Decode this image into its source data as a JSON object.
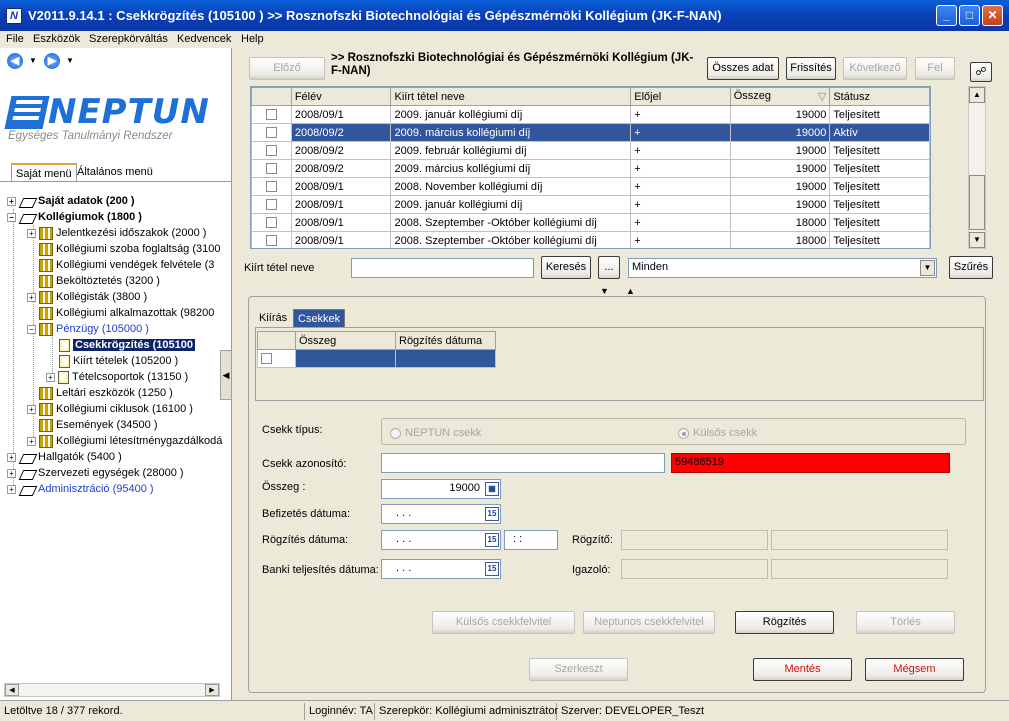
{
  "window": {
    "title": "V2011.9.14.1 : Csekkrögzítés (105100 )  >> Rosznofszki Biotechnológiai és Gépészmérnöki Kollégium (JK-F-NAN)",
    "minimize": "_",
    "maximize": "□",
    "close": "✕",
    "app_icon": "N"
  },
  "menu": [
    "File",
    "Eszközök",
    "Szerepkörváltás",
    "Kedvencek",
    "Help"
  ],
  "nav": {
    "back": "◀",
    "forward": "▶",
    "dropdown": "▼"
  },
  "logo": {
    "word": "NEPTUN",
    "tagline": "Egységes Tanulmányi Rendszer"
  },
  "left_tabs": [
    "Saját menü",
    "Általános menü"
  ],
  "tree": [
    {
      "label": "Saját adatok (200 )",
      "expander": "+"
    },
    {
      "label": "Kollégiumok (1800 )",
      "expander": "−"
    },
    {
      "label": "Jelentkezési időszakok (2000 )",
      "expander": "+"
    },
    {
      "label": "Kollégiumi szoba foglaltság (3100"
    },
    {
      "label": "Kollégiumi vendégek felvétele (3"
    },
    {
      "label": "Beköltöztetés (3200 )"
    },
    {
      "label": "Kollégisták (3800 )",
      "expander": "+"
    },
    {
      "label": "Kollégiumi alkalmazottak (98200"
    },
    {
      "label": "Pénzügy (105000 )",
      "expander": "−"
    },
    {
      "label": "Csekkrögzítés (105100"
    },
    {
      "label": "Kiírt tételek (105200 )"
    },
    {
      "label": "Tételcsoportok (13150 )",
      "expander": "+"
    },
    {
      "label": "Leltári eszközök (1250 )"
    },
    {
      "label": "Kollégiumi ciklusok (16100 )",
      "expander": "+"
    },
    {
      "label": "Események (34500 )"
    },
    {
      "label": "Kollégiumi létesítménygazdálkodá",
      "expander": "+"
    },
    {
      "label": "Hallgatók (5400 )",
      "expander": "+"
    },
    {
      "label": "Szervezeti egységek (28000 )",
      "expander": "+"
    },
    {
      "label": "Adminisztráció (95400 )",
      "expander": "+"
    }
  ],
  "toolbar": {
    "prev": "Előző",
    "title": ">> Rosznofszki Biotechnológiai és Gépészmérnöki Kollégium (JK-F-NAN)",
    "all_data": "Összes adat",
    "refresh": "Frissítés",
    "next": "Következő",
    "up": "Fel",
    "pin_icon": "☍"
  },
  "items_table": {
    "columns": [
      "",
      "Félév",
      "Kiírt tétel neve",
      "Előjel",
      "Összeg",
      "Státusz"
    ],
    "sort_marker": "▽",
    "rows": [
      {
        "felev": "2008/09/1",
        "nev": "2009. január kollégiumi díj",
        "elojel": "+",
        "osszeg": "19000",
        "statusz": "Teljesített",
        "selected": false
      },
      {
        "felev": "2008/09/2",
        "nev": "2009. március kollégiumi díj",
        "elojel": "+",
        "osszeg": "19000",
        "statusz": "Aktív",
        "selected": true
      },
      {
        "felev": "2008/09/2",
        "nev": "2009. február kollégiumi díj",
        "elojel": "+",
        "osszeg": "19000",
        "statusz": "Teljesített",
        "selected": false
      },
      {
        "felev": "2008/09/2",
        "nev": "2009. március kollégiumi díj",
        "elojel": "+",
        "osszeg": "19000",
        "statusz": "Teljesített",
        "selected": false
      },
      {
        "felev": "2008/09/1",
        "nev": "2008. November kollégiumi díj",
        "elojel": "+",
        "osszeg": "19000",
        "statusz": "Teljesített",
        "selected": false
      },
      {
        "felev": "2008/09/1",
        "nev": "2009. január kollégiumi díj",
        "elojel": "+",
        "osszeg": "19000",
        "statusz": "Teljesített",
        "selected": false
      },
      {
        "felev": "2008/09/1",
        "nev": "2008. Szeptember -Október kollégiumi díj",
        "elojel": "+",
        "osszeg": "18000",
        "statusz": "Teljesített",
        "selected": false
      },
      {
        "felev": "2008/09/1",
        "nev": "2008. Szeptember -Október kollégiumi díj",
        "elojel": "+",
        "osszeg": "18000",
        "statusz": "Teljesített",
        "selected": false
      }
    ]
  },
  "filter": {
    "label": "Kiírt tétel neve",
    "value": "",
    "search": "Keresés",
    "ellipsis": "...",
    "select_value": "Minden",
    "filter_btn": "Szűrés"
  },
  "splitter": {
    "down": "▼",
    "up": "▲"
  },
  "tabs": [
    "Kiírás",
    "Csekkek"
  ],
  "check_table": {
    "columns": [
      "",
      "Összeg",
      "Rögzítés dátuma"
    ]
  },
  "form": {
    "type_label": "Csekk típus:",
    "radio_neptun": "NEPTUN csekk",
    "radio_kulsos": "Külsős csekk",
    "id_label": "Csekk azonosító:",
    "id_value": "",
    "id_red_value": "59486519",
    "amount_label": "Összeg :",
    "amount_value": "19000",
    "pay_date_label": "Befizetés dátuma:",
    "date_placeholder": ". . .",
    "rec_date_label": "Rögzítés dátuma:",
    "time_placeholder": ": :",
    "recorder_label": "Rögzítő:",
    "bank_date_label": "Banki teljesítés dátuma:",
    "approver_label": "Igazoló:",
    "calendar_icon": "15",
    "calc_icon": "▦"
  },
  "actions": {
    "external_check": "Külsős csekkfelvitel",
    "neptun_check": "Neptunos csekkfelvitel",
    "record": "Rögzítés",
    "delete": "Törlés",
    "edit": "Szerkeszt",
    "save": "Mentés",
    "cancel": "Mégsem"
  },
  "colors": {
    "selected_row": "#31569c",
    "highlight_red": "#ff0000",
    "brand": "#1f6fd8"
  },
  "status": {
    "loaded": "Letöltve 18 / 377 rekord.",
    "login": "Loginnév: TA",
    "role": "Szerepkör: Kollégiumi adminisztrátor",
    "server": "Szerver: DEVELOPER_Teszt"
  }
}
